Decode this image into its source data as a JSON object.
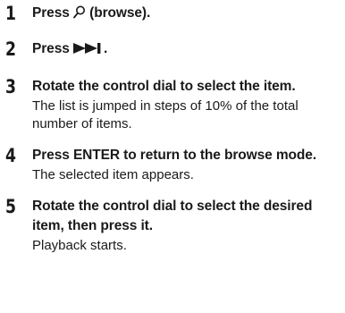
{
  "steps": [
    {
      "number": "1",
      "instruction_before": "Press",
      "icon": "search-icon",
      "instruction_after": "(browse)."
    },
    {
      "number": "2",
      "instruction_before": "Press",
      "icon": "next-track-icon",
      "instruction_after": "."
    },
    {
      "number": "3",
      "instruction": "Rotate the control dial to select the item.",
      "result": "The list is jumped in steps of 10% of the total number of items."
    },
    {
      "number": "4",
      "instruction": "Press ENTER to return to the browse mode.",
      "result": "The selected item appears."
    },
    {
      "number": "5",
      "instruction": "Rotate the control dial to select the desired item, then press it.",
      "result": "Playback starts."
    }
  ]
}
